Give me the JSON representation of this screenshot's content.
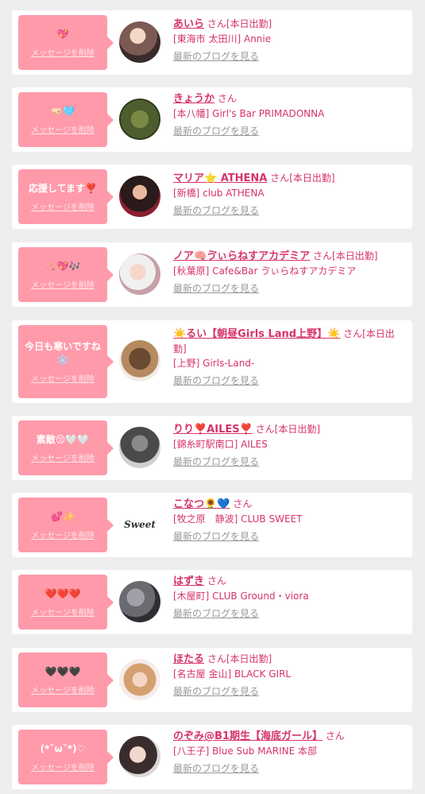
{
  "delete_label": "メッセージを削除",
  "san_label": "さん",
  "blog_label": "最新のブログを見る",
  "cards": [
    {
      "message": "💖",
      "name": "あいら",
      "status": "[本日出勤]",
      "shop": "[東海市 太田川] Annie"
    },
    {
      "message": "🤜🏻🩵",
      "name": "きょうか",
      "status": "",
      "shop": "[本八幡] Girl's Bar PRIMADONNA"
    },
    {
      "message": "応援してます❣️",
      "name": "マリア⭐ ATHENA",
      "status": "[本日出勤]",
      "shop": "[新橋] club ATHENA"
    },
    {
      "message": "🧠💖🎶",
      "name": "ノア🧠ゔぃらねすアカデミア",
      "status": "[本日出勤]",
      "shop": "[秋葉原] Cafe&Bar ゔぃらねすアカデミア"
    },
    {
      "message": "今日も寒いですね❄️",
      "name": "☀️るい【朝昼Girls Land上野】☀️",
      "status": "[本日出勤]",
      "shop": "[上野] Girls-Land-"
    },
    {
      "message": "素敵😚🤍🤍",
      "name": "りり❣️AILES❣️",
      "status": "[本日出勤]",
      "shop": "[錦糸町駅南口] AILES"
    },
    {
      "message": "💕✨",
      "name": "こなつ🌻💙",
      "status": "",
      "shop": "[牧之原　静波] CLUB SWEET",
      "avatar_text": "Sweet"
    },
    {
      "message": "❤️❤️❤️",
      "name": "はずき",
      "status": "",
      "shop": "[木屋町] CLUB Ground・viora"
    },
    {
      "message": "🖤🖤🖤",
      "name": "ほたる",
      "status": "[本日出勤]",
      "shop": "[名古屋 金山] BLACK GIRL"
    },
    {
      "message": "(*ˇωˇ*)♡",
      "name": "のぞみ@B1期生【海底ガール】",
      "status": "",
      "shop": "[八王子] Blue Sub MARINE 本部"
    }
  ],
  "colors": {
    "bubble": "#ff9aaa",
    "accent": "#d6336c",
    "link_gray": "#999999"
  }
}
